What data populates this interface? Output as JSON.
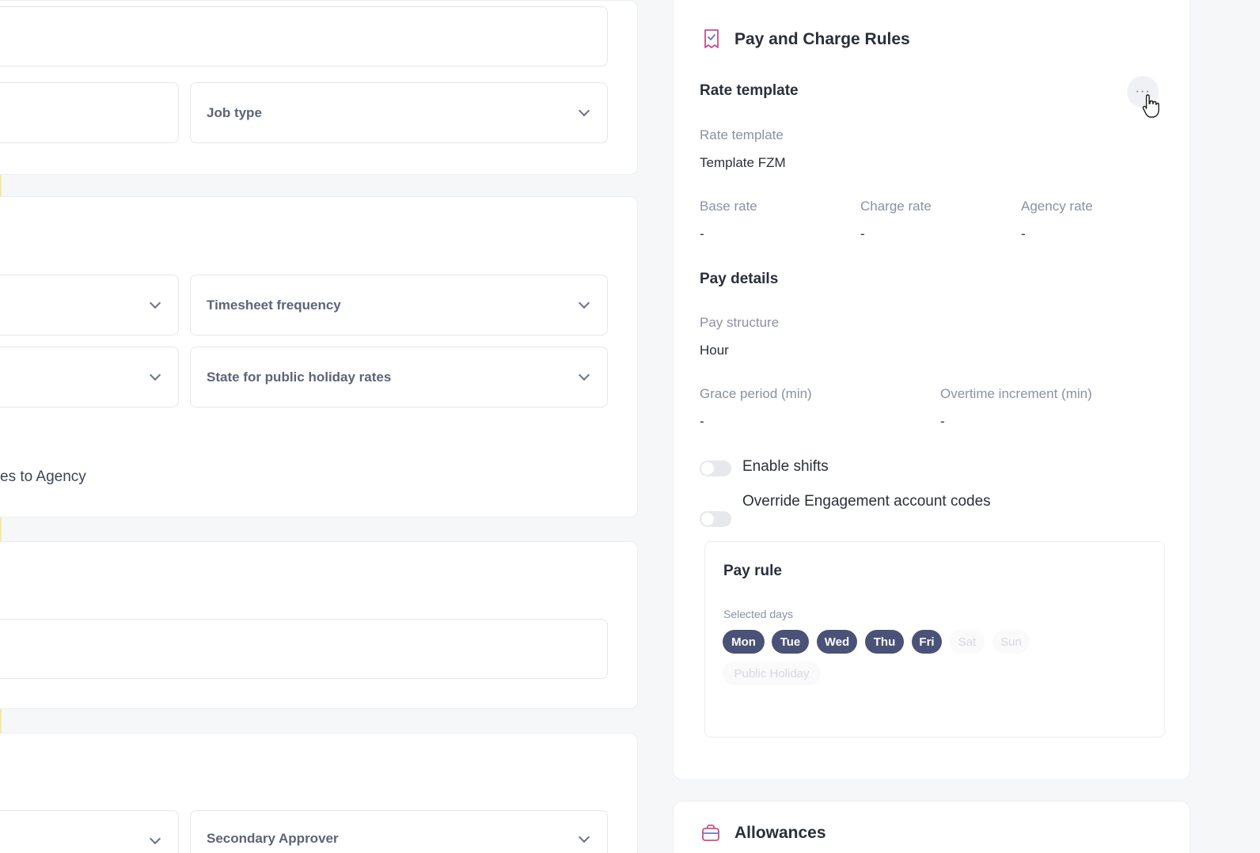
{
  "left": {
    "job_type": "Job type",
    "timesheet_frequency": "Timesheet frequency",
    "state_public_holiday": "State for public holiday rates",
    "partial_text": "es to Agency",
    "secondary_approver": "Secondary Approver"
  },
  "pay_charge": {
    "title": "Pay and Charge Rules",
    "rate_template_heading": "Rate template",
    "more_label": "···",
    "rate_template_label": "Rate template",
    "rate_template_value": "Template FZM",
    "base_rate_label": "Base rate",
    "base_rate_value": "-",
    "charge_rate_label": "Charge rate",
    "charge_rate_value": "-",
    "agency_rate_label": "Agency rate",
    "agency_rate_value": "-",
    "pay_details_heading": "Pay details",
    "pay_structure_label": "Pay structure",
    "pay_structure_value": "Hour",
    "grace_period_label": "Grace period (min)",
    "grace_period_value": "-",
    "overtime_label": "Overtime increment (min)",
    "overtime_value": "-",
    "enable_shifts_label": "Enable shifts",
    "override_codes_label": "Override Engagement account codes",
    "pay_rule": {
      "heading": "Pay rule",
      "selected_days_label": "Selected days",
      "days": [
        "Mon",
        "Tue",
        "Wed",
        "Thu",
        "Fri",
        "Sat",
        "Sun"
      ],
      "public_holiday": "Public Holiday"
    }
  },
  "allowances": {
    "title": "Allowances"
  },
  "colors": {
    "accent": "#4a5278",
    "icon": "#c94f8a"
  }
}
